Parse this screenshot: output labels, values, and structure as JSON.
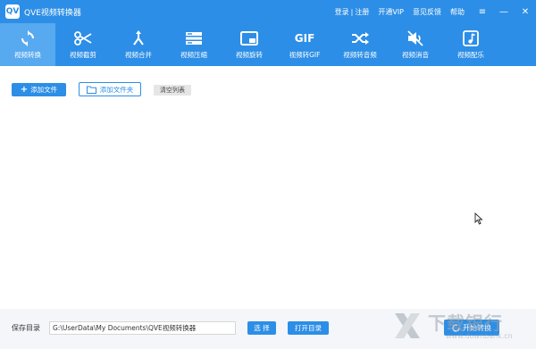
{
  "window": {
    "logo_text": "QV",
    "title": "QVE视频转换器",
    "links": {
      "login": "登录",
      "divider": "|",
      "register": "注册",
      "vip": "开通VIP",
      "feedback": "意见反馈",
      "help": "帮助"
    },
    "controls": {
      "menu": "≡",
      "minimize": "—",
      "close": "✕"
    }
  },
  "toolbar": {
    "items": [
      {
        "label": "视频转换",
        "icon": "convert-icon"
      },
      {
        "label": "视频截剪",
        "icon": "scissors-icon"
      },
      {
        "label": "视频合并",
        "icon": "merge-icon"
      },
      {
        "label": "视频压缩",
        "icon": "compress-icon"
      },
      {
        "label": "视频旋转",
        "icon": "rotate-icon"
      },
      {
        "label": "视频转GIF",
        "icon": "gif-icon",
        "icon_text": "GIF"
      },
      {
        "label": "视频转音频",
        "icon": "shuffle-icon"
      },
      {
        "label": "视频消音",
        "icon": "mute-icon"
      },
      {
        "label": "视频配乐",
        "icon": "music-icon"
      }
    ],
    "active_index": 0
  },
  "actions": {
    "add_file": "添加文件",
    "add_folder": "添加文件夹",
    "clear_list": "清空列表"
  },
  "bottom": {
    "save_label": "保存目录",
    "save_path": "G:\\UserData\\My Documents\\QVE视频转换器",
    "select_button": "选 择",
    "open_button": "打开目录",
    "start_button": "开始转换"
  },
  "watermark": {
    "text": "下载银行",
    "sub": "www.downbank.cn"
  },
  "colors": {
    "primary": "#2c8ee6",
    "active_tab": "#57a9f0",
    "bottom_bar": "#f4f6f9"
  }
}
